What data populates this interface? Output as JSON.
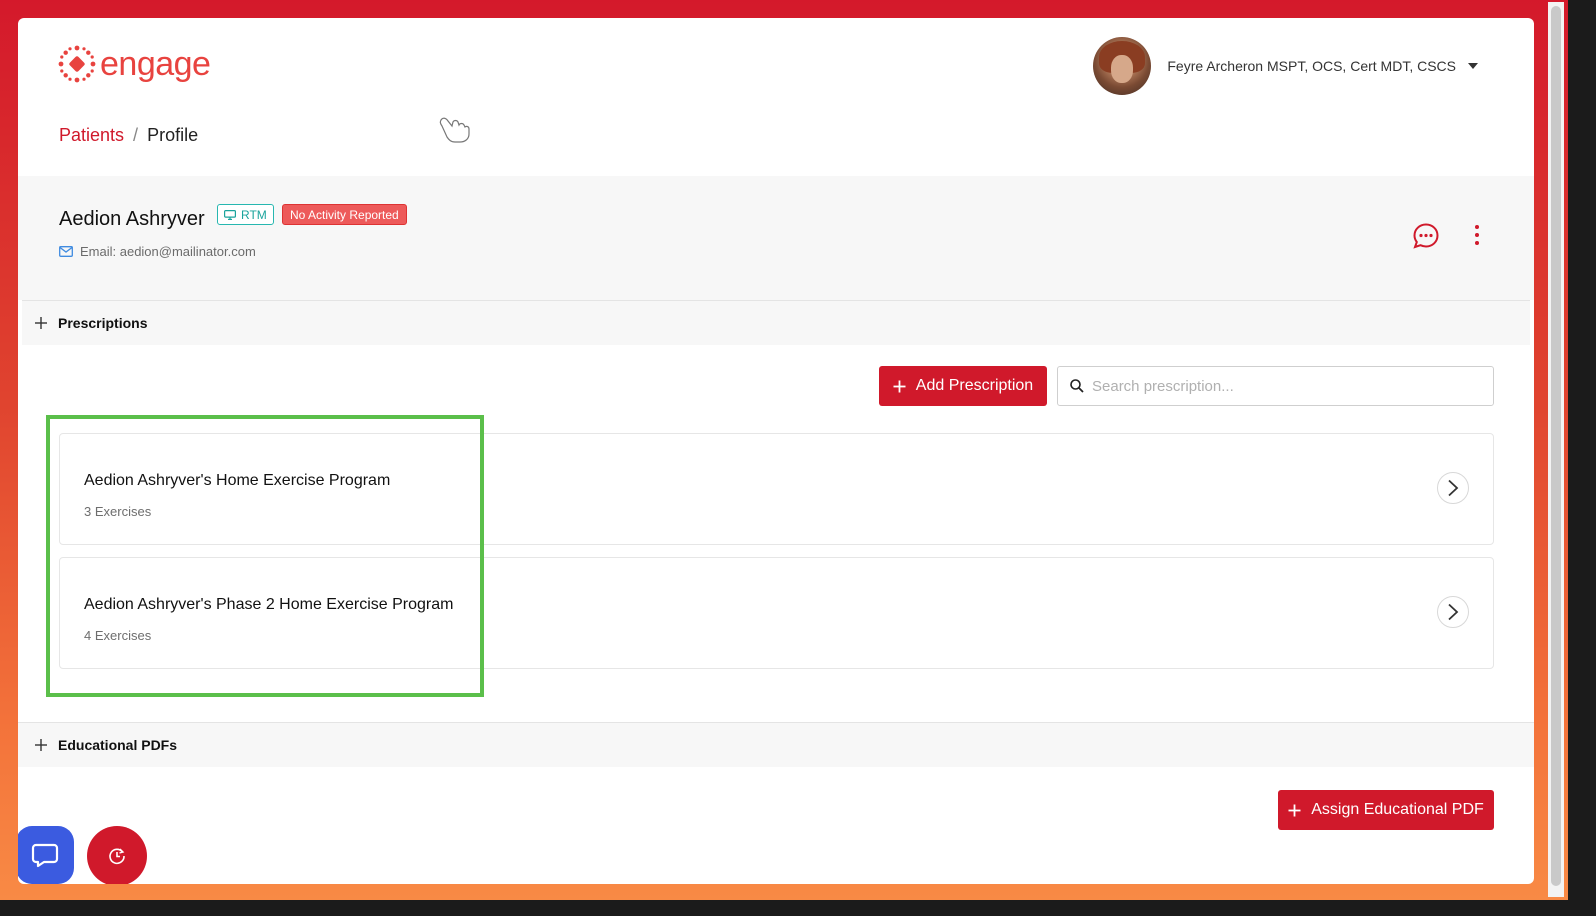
{
  "brand": {
    "name": "engage",
    "accent": "#d0192b",
    "logo_color": "#e8433f"
  },
  "user": {
    "name": "Feyre Archeron MSPT, OCS, Cert MDT, CSCS",
    "menu_icon": "caret-down-icon"
  },
  "breadcrumb": {
    "parent": "Patients",
    "separator": "/",
    "current": "Profile"
  },
  "patient": {
    "name": "Aedion Ashryver",
    "badges": {
      "rtm": "RTM",
      "activity": "No Activity Reported"
    },
    "email": "Email: aedion@mailinator.com"
  },
  "sections": {
    "prescriptions": "Prescriptions",
    "educational": "Educational PDFs"
  },
  "actions": {
    "add_prescription": "Add Prescription",
    "search_placeholder": "Search prescription...",
    "assign_pdf": "Assign Educational PDF"
  },
  "prescriptions": [
    {
      "title": "Aedion Ashryver's Home Exercise Program",
      "count": "3 Exercises"
    },
    {
      "title": "Aedion Ashryver's Phase 2 Home Exercise Program",
      "count": "4 Exercises"
    }
  ],
  "colors": {
    "highlight": "#5bbf4a",
    "rtm": "#1aa39c",
    "activity_badge": "#ed5a5a",
    "chat_fab": "#3b5be0"
  }
}
